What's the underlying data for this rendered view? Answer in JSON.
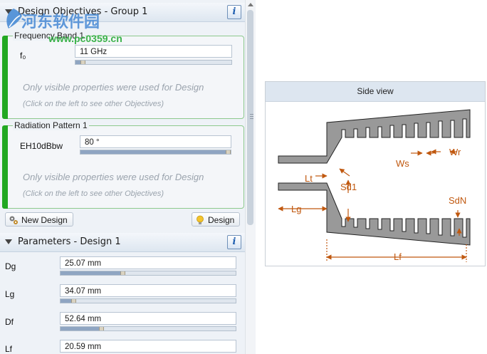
{
  "objectives": {
    "header_title": "Design Objectives  -  Group 1",
    "info_label": "i",
    "groups": [
      {
        "legend": "Frequency Band 1",
        "param_label": "f₀",
        "value": "11 GHz",
        "slider_fraction": 0.03,
        "note_line1": "Only visible properties were used for Design",
        "note_line2": "(Click on the left to see other Objectives)"
      },
      {
        "legend": "Radiation Pattern 1",
        "param_label": "EH10dBbw",
        "value": "80 °",
        "slider_fraction": 0.97,
        "note_line1": "Only visible properties were used for Design",
        "note_line2": "(Click on the left to see other Objectives)"
      }
    ],
    "new_design_label": "New Design",
    "design_label": "Design"
  },
  "parameters": {
    "header_title": "Parameters  -  Design 1",
    "info_label": "i",
    "rows": [
      {
        "label": "Dg",
        "value": "25.07 mm",
        "fraction": 0.34
      },
      {
        "label": "Lg",
        "value": "34.07 mm",
        "fraction": 0.06
      },
      {
        "label": "Df",
        "value": "52.64 mm",
        "fraction": 0.22
      },
      {
        "label": "Lf",
        "value": "20.59 mm",
        "fraction": 0.1
      }
    ]
  },
  "side_view": {
    "title": "Side view",
    "labels": {
      "lt": "Lt",
      "sd1": "Sd1",
      "lg": "Lg",
      "ws": "Ws",
      "wr": "Wr",
      "sdn": "SdN",
      "lf": "Lf"
    }
  },
  "watermark": {
    "line1": "河东软件园",
    "line2": "www.pc0359.cn"
  },
  "colors": {
    "accent_green": "#22a822",
    "dim_orange": "#c0580f",
    "horn_gray": "#999999"
  }
}
